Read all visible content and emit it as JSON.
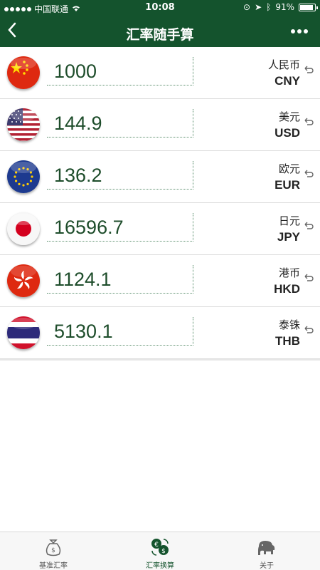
{
  "status_bar": {
    "carrier": "中国联通",
    "time": "10:08",
    "battery": "91%"
  },
  "nav": {
    "title": "汇率随手算",
    "back_icon": "chevron-left-icon",
    "more_icon": "more-dots-icon"
  },
  "currencies": [
    {
      "flag": "china-flag-icon",
      "amount": "1000",
      "name": "人民币",
      "code": "CNY"
    },
    {
      "flag": "usa-flag-icon",
      "amount": "144.9",
      "name": "美元",
      "code": "USD"
    },
    {
      "flag": "eu-flag-icon",
      "amount": "136.2",
      "name": "欧元",
      "code": "EUR"
    },
    {
      "flag": "japan-flag-icon",
      "amount": "16596.7",
      "name": "日元",
      "code": "JPY"
    },
    {
      "flag": "hongkong-flag-icon",
      "amount": "1124.1",
      "name": "港币",
      "code": "HKD"
    },
    {
      "flag": "thailand-flag-icon",
      "amount": "5130.1",
      "name": "泰铢",
      "code": "THB"
    }
  ],
  "tabs": [
    {
      "label": "基准汇率",
      "icon": "money-bag-icon"
    },
    {
      "label": "汇率换算",
      "icon": "currency-exchange-icon",
      "active": true
    },
    {
      "label": "关于",
      "icon": "elephant-icon"
    }
  ],
  "colors": {
    "brand": "#14532d",
    "amount_text": "#1e4d2b"
  }
}
